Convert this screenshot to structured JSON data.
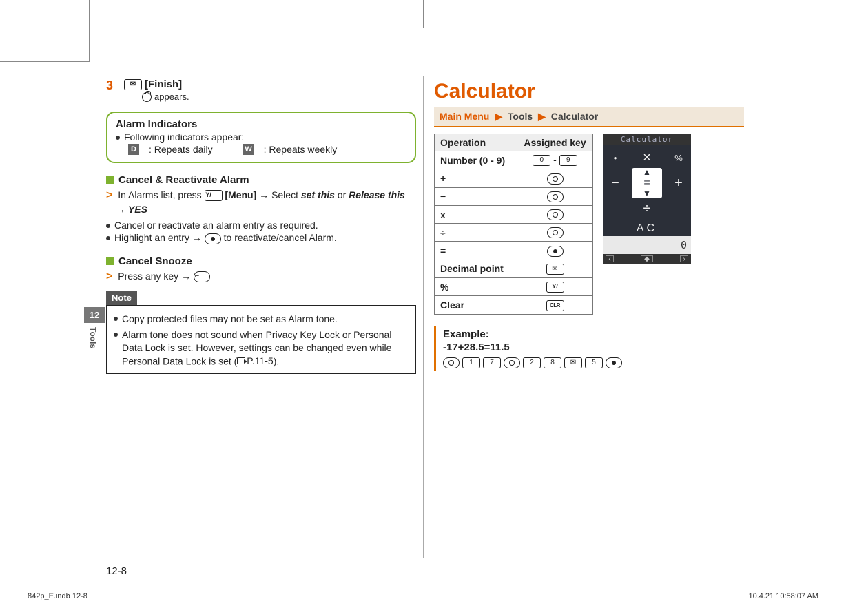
{
  "sidebar": {
    "chapter_num": "12",
    "chapter_label": "Tools"
  },
  "left": {
    "step3": {
      "num": "3",
      "finish_label": "[Finish]",
      "appears": "appears."
    },
    "alarm_box": {
      "title": "Alarm Indicators",
      "line": "Following indicators appear:",
      "daily_badge": "D",
      "daily_text": ": Repeats daily",
      "weekly_badge": "W",
      "weekly_text": ": Repeats weekly"
    },
    "cancel_reactivate": {
      "title": "Cancel & Reactivate Alarm",
      "step_pre": "In Alarms list, press ",
      "menu_label": "[Menu]",
      "select_word": " Select ",
      "set_this": "set this",
      "or_word": " or ",
      "release_this": "Release this",
      "yes": "YES",
      "bullet1": "Cancel or reactivate an alarm entry as required.",
      "bullet2a": "Highlight an entry ",
      "bullet2b": " to reactivate/cancel Alarm."
    },
    "cancel_snooze": {
      "title": "Cancel Snooze",
      "line_pre": "Press any key "
    },
    "note": {
      "title": "Note",
      "b1": "Copy protected files may not be set as Alarm tone.",
      "b2": "Alarm tone does not sound when Privacy Key Lock or Personal Data Lock is set. However, settings can be changed even while Personal Data Lock is set (",
      "b2_ref": "P.11-5",
      "b2_end": ")."
    }
  },
  "right": {
    "h1": "Calculator",
    "breadcrumb": {
      "a": "Main Menu",
      "b": "Tools",
      "c": "Calculator"
    },
    "table": {
      "headers": [
        "Operation",
        "Assigned key"
      ],
      "rows": [
        {
          "op": "Number (0 - 9)",
          "keys": [
            {
              "t": "rect",
              "label": "0"
            },
            {
              "t": "text",
              "label": " - "
            },
            {
              "t": "rect",
              "label": "9"
            }
          ]
        },
        {
          "op": "+",
          "keys": [
            {
              "t": "oval-ring-top"
            }
          ]
        },
        {
          "op": "−",
          "keys": [
            {
              "t": "oval-ring-bottom"
            }
          ]
        },
        {
          "op": "x",
          "keys": [
            {
              "t": "oval-ring-left"
            }
          ]
        },
        {
          "op": "÷",
          "keys": [
            {
              "t": "oval-ring-right"
            }
          ]
        },
        {
          "op": "=",
          "keys": [
            {
              "t": "oval-dot"
            }
          ]
        },
        {
          "op": "Decimal point",
          "keys": [
            {
              "t": "rect-mail"
            }
          ]
        },
        {
          "op": "%",
          "keys": [
            {
              "t": "rect-y"
            }
          ]
        },
        {
          "op": "Clear",
          "keys": [
            {
              "t": "rect-clr"
            }
          ]
        }
      ]
    },
    "phone": {
      "title": "Calculator",
      "ac": "AC",
      "display": "0"
    },
    "example": {
      "title": "Example:",
      "calc": "-17+28.5=11.5",
      "keys": [
        {
          "t": "oval-ring-bottom"
        },
        {
          "t": "rect",
          "label": "1"
        },
        {
          "t": "rect",
          "label": "7"
        },
        {
          "t": "oval-ring-top"
        },
        {
          "t": "rect",
          "label": "2"
        },
        {
          "t": "rect",
          "label": "8"
        },
        {
          "t": "rect-mail"
        },
        {
          "t": "rect",
          "label": "5"
        },
        {
          "t": "oval-dot"
        }
      ]
    }
  },
  "page_num": "12-8",
  "footer": {
    "left": "842p_E.indb   12-8",
    "right": "10.4.21   10:58:07 AM"
  }
}
